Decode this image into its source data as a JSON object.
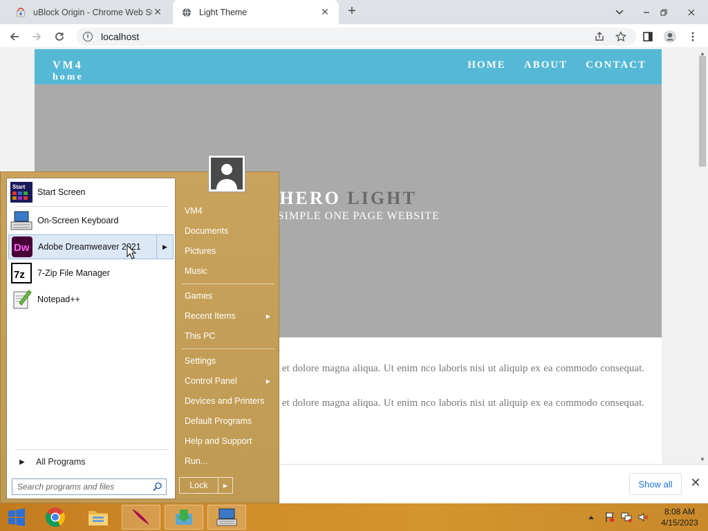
{
  "browser": {
    "tabs": [
      {
        "title": "uBlock Origin - Chrome Web Sto",
        "icon": "chrome-web-store-icon",
        "active": false
      },
      {
        "title": "Light Theme",
        "icon": "globe-icon",
        "active": true
      }
    ],
    "address": "localhost"
  },
  "website": {
    "logo_line1": "VM4",
    "logo_line2": "home",
    "nav": [
      "HOME",
      "ABOUT",
      "CONTACT"
    ],
    "hero_title_a": "HERO ",
    "hero_title_b": "LIGHT",
    "hero_subtitle": "S A SIMPLE ONE PAGE WEBSITE",
    "paragraph1": "g elit, sed do eiusmod tempor incididunt ut labore et dolore magna aliqua. Ut enim nco laboris nisi ut aliquip ex ea commodo consequat. Duis aute irure dolor in u fugiat nulla pariatur.",
    "paragraph2": "g elit, sed do eiusmod tempor incididunt ut labore et dolore magna aliqua. Ut enim nco laboris nisi ut aliquip ex ea commodo consequat. Duis aute irure dolor in u fugiat nulla pariatur."
  },
  "download_bar": {
    "show_all": "Show all"
  },
  "start_menu": {
    "programs": [
      {
        "label": "Start Screen",
        "icon": "start-screen-icon"
      },
      {
        "label": "On-Screen Keyboard",
        "icon": "keyboard-icon"
      },
      {
        "label": "Adobe Dreamweaver 2021",
        "icon": "dreamweaver-icon",
        "highlighted": true,
        "icon_text": "Dw"
      },
      {
        "label": "7-Zip File Manager",
        "icon": "7zip-icon",
        "icon_text": "7z"
      },
      {
        "label": "Notepad++",
        "icon": "notepadpp-icon"
      }
    ],
    "all_programs": "All Programs",
    "search_placeholder": "Search programs and files",
    "right_items": [
      "VM4",
      "Documents",
      "Pictures",
      "Music",
      "Games",
      "Recent Items",
      "This PC",
      "Settings",
      "Control Panel",
      "Devices and Printers",
      "Default Programs",
      "Help and Support",
      "Run..."
    ],
    "lock": "Lock",
    "start_icon_text": "Start"
  },
  "taskbar": {
    "time": "8:08 AM",
    "date": "4/15/2023"
  },
  "colors": {
    "site_nav": "#55b9d6",
    "hero_bg": "#aaaaaa",
    "start_menu": "#c9a35c",
    "taskbar": "#d08a28",
    "link_blue": "#1a73e8"
  }
}
